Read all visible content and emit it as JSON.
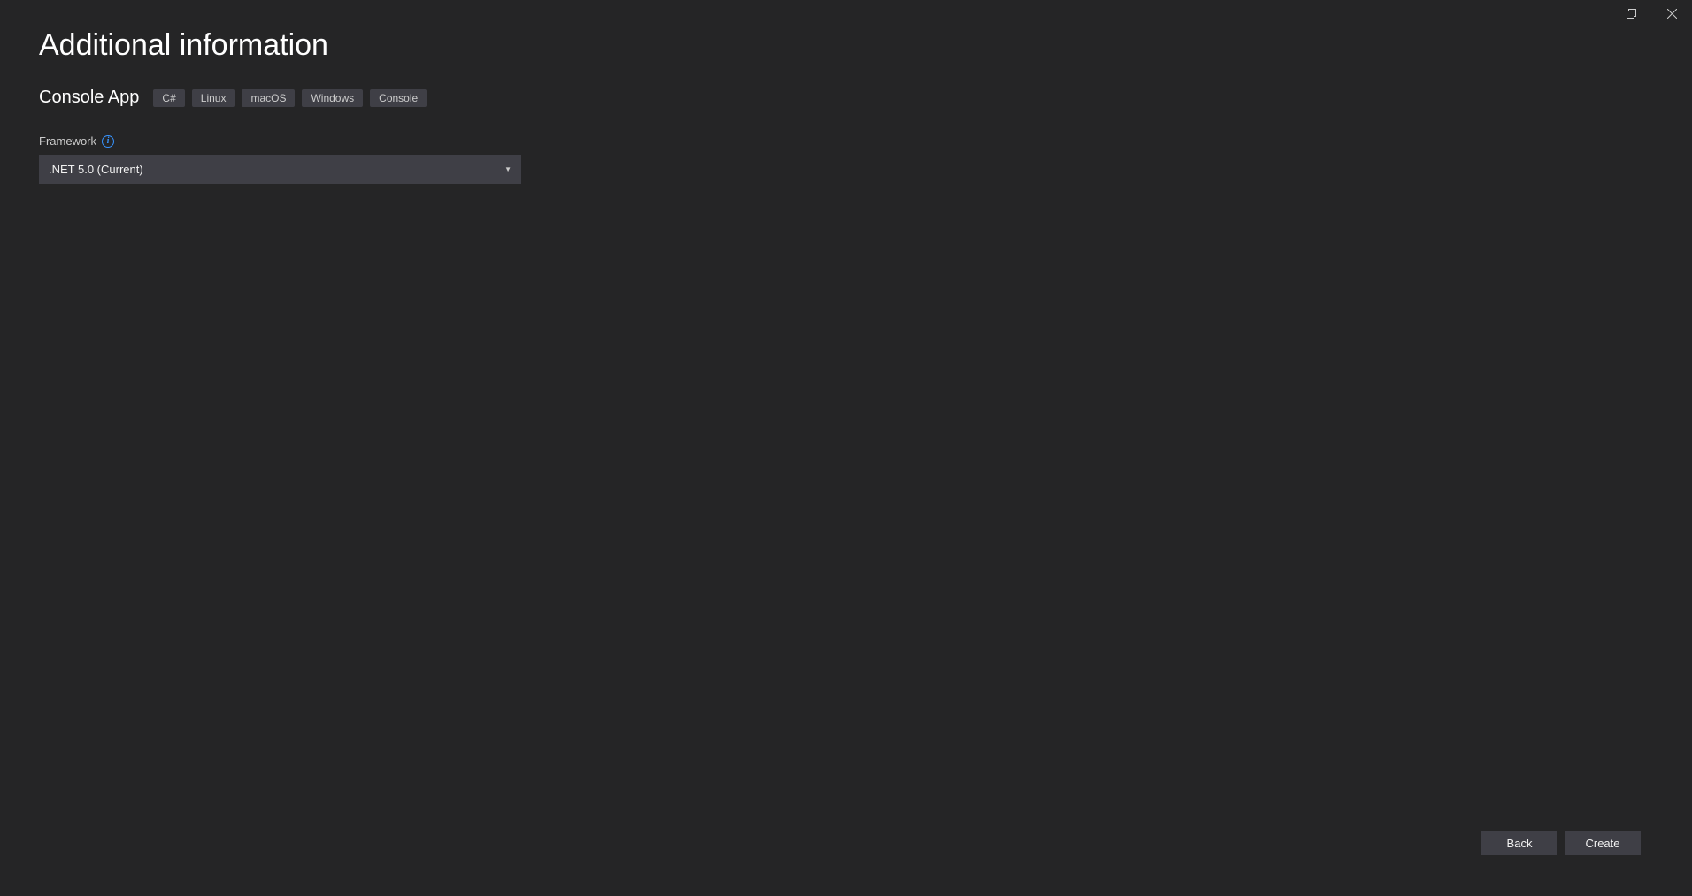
{
  "header": {
    "title": "Additional information"
  },
  "template": {
    "name": "Console App",
    "tags": [
      "C#",
      "Linux",
      "macOS",
      "Windows",
      "Console"
    ]
  },
  "form": {
    "framework": {
      "label": "Framework",
      "selected": ".NET 5.0 (Current)"
    }
  },
  "footer": {
    "back_label": "Back",
    "create_label": "Create"
  }
}
